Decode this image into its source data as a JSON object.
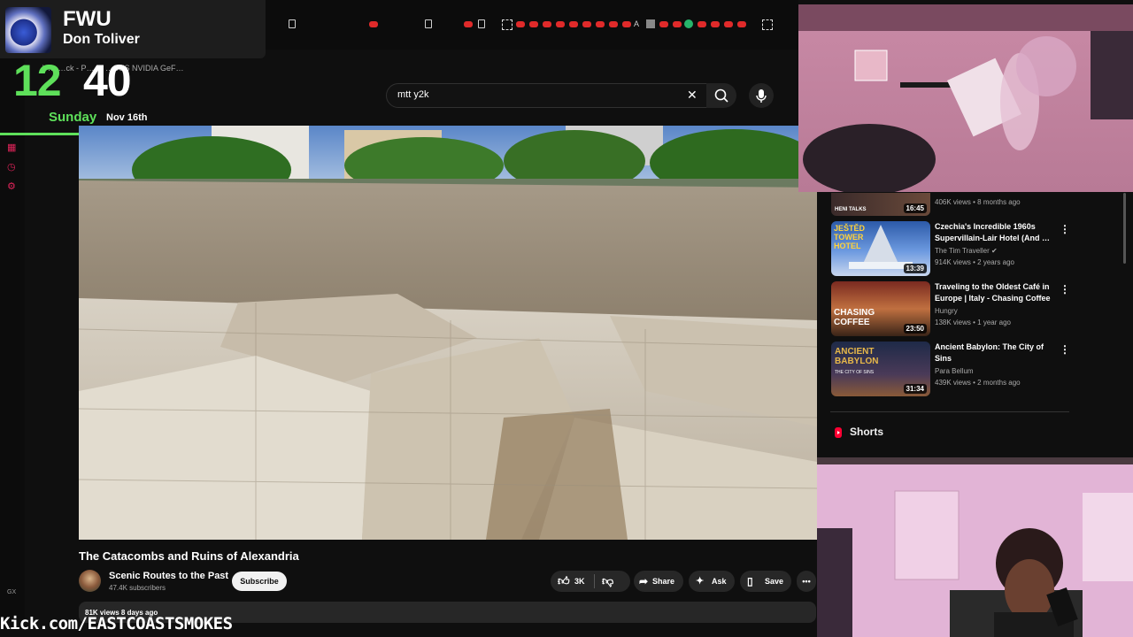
{
  "now_playing": {
    "title": "FWU",
    "artist": "Don Toliver"
  },
  "clock": {
    "hour": "12",
    "minute": "40",
    "day": "Sunday",
    "date": "Nov 16th"
  },
  "bookmarks": {
    "text": "V… …ck - P…     …SUS NVIDIA GeF…"
  },
  "search": {
    "query": "mtt y2k"
  },
  "video": {
    "title": "The Catacombs and Ruins of Alexandria"
  },
  "channel": {
    "name": "Scenic Routes to the Past",
    "subscribers": "47.4K subscribers",
    "subscribe_label": "Subscribe"
  },
  "actions": {
    "likes": "3K",
    "share": "Share",
    "ask": "Ask",
    "save": "Save"
  },
  "stats": "81K views  8 days ago",
  "recommended": [
    {
      "meta": "406K views • 8 months ago",
      "duration": "16:45",
      "thumb_text": "HENI TALKS"
    },
    {
      "title": "Czechia's Incredible 1960s Supervillain-Lair Hotel (And …",
      "channel": "The Tim Traveller",
      "meta": "914K views • 2 years ago",
      "duration": "13:39",
      "thumb_text": "JEŠTĚD TOWER HOTEL"
    },
    {
      "title": "Traveling to the Oldest Café in Europe | Italy - Chasing Coffee",
      "channel": "Hungry",
      "meta": "138K views • 1 year ago",
      "duration": "23:50",
      "thumb_text": "CHASING COFFEE"
    },
    {
      "title": "Ancient Babylon: The City of Sins",
      "channel": "Para Bellum",
      "meta": "439K views • 2 months ago",
      "duration": "31:34",
      "thumb_text": "ANCIENT BABYLON",
      "thumb_sub": "THE CITY OF SINS"
    }
  ],
  "shorts_label": "Shorts",
  "gx_label": "GX",
  "kick": "Kick.com/EASTCOASTSMOKES",
  "colors": {
    "accent_green": "#5ee05a",
    "youtube_red": "#ff0033",
    "gx_pink": "#e0245a"
  }
}
